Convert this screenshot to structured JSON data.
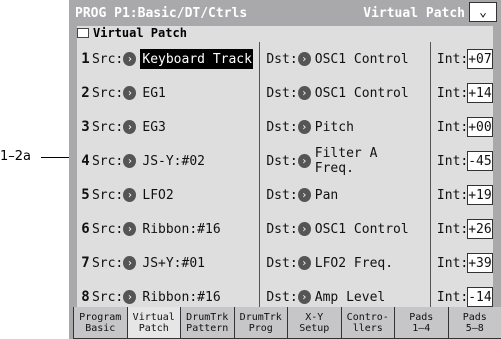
{
  "callout": "1–2a",
  "header": {
    "title": "PROG P1:Basic/DT/Ctrls",
    "patch": "Virtual Patch",
    "menu_icon": "chevron-down-icon"
  },
  "section": {
    "title": "Virtual Patch"
  },
  "labels": {
    "src": "Src:",
    "dst": "Dst:",
    "int": "Int:"
  },
  "rows": [
    {
      "num": "1",
      "src": "Keyboard Track",
      "dst": "OSC1 Control",
      "int": "+07"
    },
    {
      "num": "2",
      "src": "EG1",
      "dst": "OSC1 Control",
      "int": "+14"
    },
    {
      "num": "3",
      "src": "EG3",
      "dst": "Pitch",
      "int": "+00"
    },
    {
      "num": "4",
      "src": "JS-Y:#02",
      "dst": "Filter A Freq.",
      "int": "-45"
    },
    {
      "num": "5",
      "src": "LFO2",
      "dst": "Pan",
      "int": "+19"
    },
    {
      "num": "6",
      "src": "Ribbon:#16",
      "dst": "OSC1 Control",
      "int": "+26"
    },
    {
      "num": "7",
      "src": "JS+Y:#01",
      "dst": "LFO2 Freq.",
      "int": "+39"
    },
    {
      "num": "8",
      "src": "Ribbon:#16",
      "dst": "Amp Level",
      "int": "-14"
    }
  ],
  "tabs": [
    {
      "l1": "Program",
      "l2": "Basic"
    },
    {
      "l1": "Virtual",
      "l2": "Patch"
    },
    {
      "l1": "DrumTrk",
      "l2": "Pattern"
    },
    {
      "l1": "DrumTrk",
      "l2": "Prog"
    },
    {
      "l1": "X-Y",
      "l2": "Setup"
    },
    {
      "l1": "Contro-",
      "l2": "llers"
    },
    {
      "l1": "Pads",
      "l2": "1–4"
    },
    {
      "l1": "Pads",
      "l2": "5–8"
    }
  ]
}
